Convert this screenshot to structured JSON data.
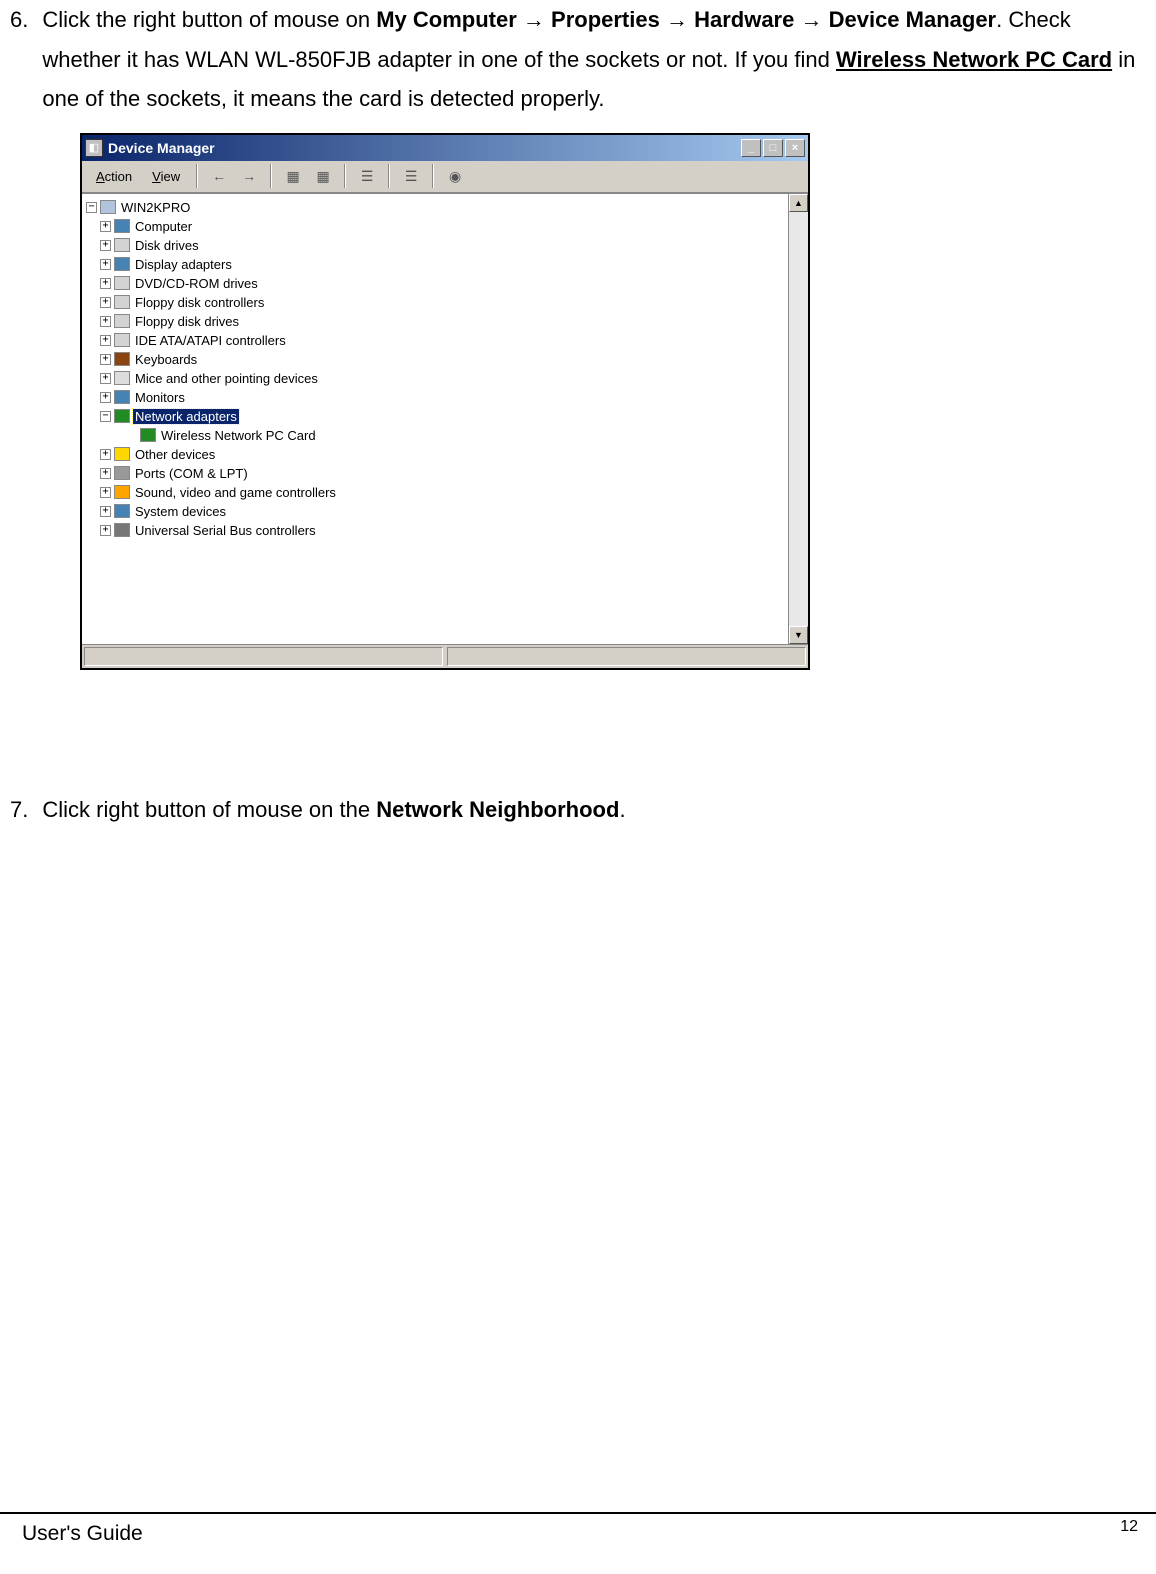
{
  "step6": {
    "num": "6.",
    "text_a": "Click the right button of mouse on ",
    "my_computer": "My Computer",
    "arrow": " → ",
    "properties": "Properties",
    "hardware": "Hardware",
    "device_manager": "Device Manager",
    "text_b": ". Check whether it has WLAN WL-850FJB adapter in one of the sockets or not.  If you find ",
    "wireless": "Wireless Network PC Card",
    "text_c": " in one of the sockets, it means the card is detected properly."
  },
  "dm": {
    "title": "Device Manager",
    "menu_action": "Action",
    "menu_view": "View",
    "root": "WIN2KPRO",
    "items": {
      "computer": "Computer",
      "disk": "Disk drives",
      "display": "Display adapters",
      "dvd": "DVD/CD-ROM drives",
      "floppy_ctrl": "Floppy disk controllers",
      "floppy": "Floppy disk drives",
      "ide": "IDE ATA/ATAPI controllers",
      "keyboards": "Keyboards",
      "mice": "Mice and other pointing devices",
      "monitors": "Monitors",
      "network": "Network adapters",
      "wireless_card": "Wireless Network PC Card",
      "other": "Other devices",
      "ports": "Ports (COM & LPT)",
      "sound": "Sound, video and game controllers",
      "system": "System devices",
      "usb": "Universal Serial Bus controllers"
    }
  },
  "step7": {
    "num": "7.",
    "text_a": "Click right button of mouse on the ",
    "nn": "Network Neighborhood",
    "text_b": "."
  },
  "footer": {
    "guide": "User's Guide",
    "page": "12"
  }
}
